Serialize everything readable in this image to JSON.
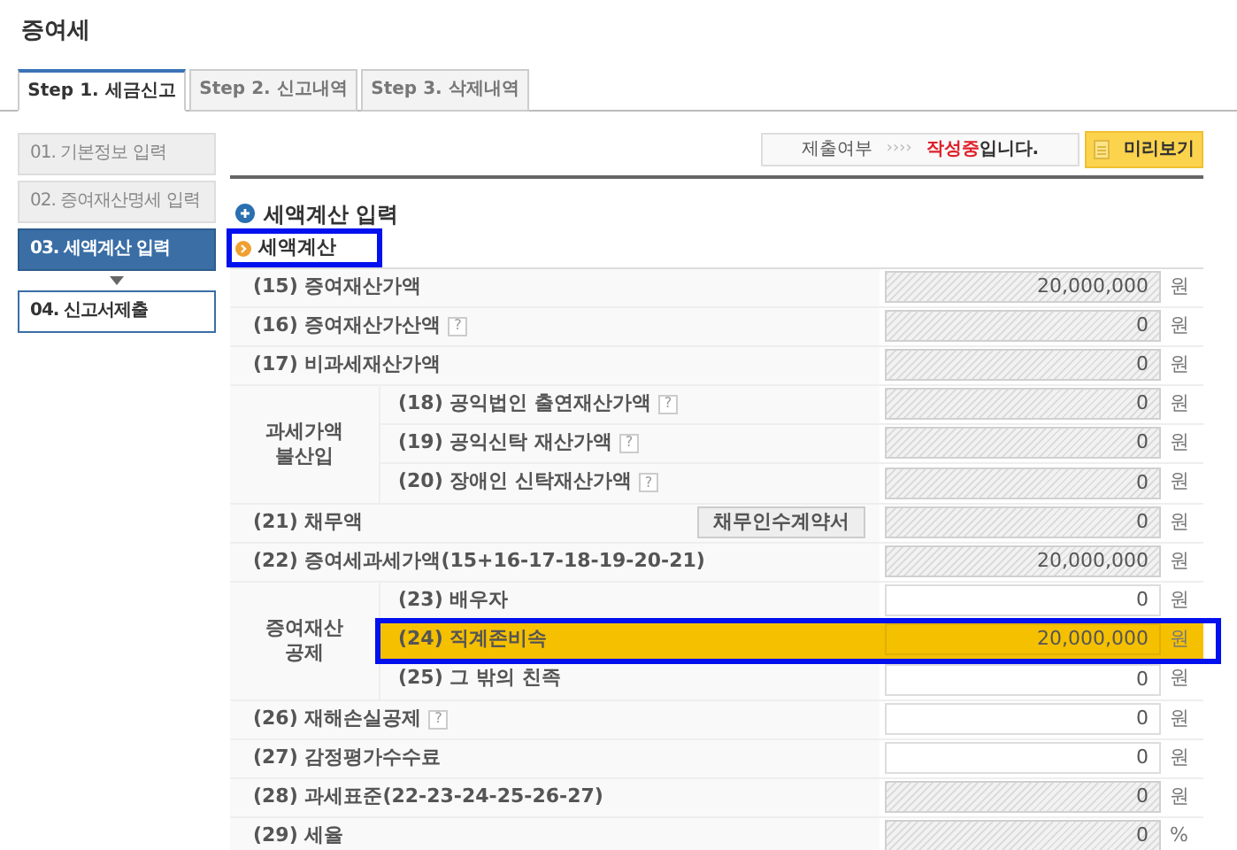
{
  "page_title": "증여세",
  "tabs": [
    {
      "label": "Step 1. 세금신고",
      "selected": true
    },
    {
      "label": "Step 2. 신고내역",
      "selected": false
    },
    {
      "label": "Step 3. 삭제내역",
      "selected": false
    }
  ],
  "steps": [
    {
      "label": "01. 기본정보 입력",
      "selected": false,
      "completed": true
    },
    {
      "label": "02. 증여재산명세 입력",
      "selected": false,
      "completed": true
    },
    {
      "label": "03. 세액계산 입력",
      "selected": true,
      "completed": false
    },
    {
      "label": "04. 신고서제출",
      "selected": false,
      "completed": false
    }
  ],
  "status": {
    "label": "제출여부",
    "arrows": "››››",
    "state": "작성중",
    "suffix": "입니다."
  },
  "preview_button": "미리보기",
  "section_title": "세액계산 입력",
  "subsection": {
    "title": "세액계산",
    "highlighted": true
  },
  "rows": [
    {
      "kind": "single",
      "label": "(15) 증여재산가액",
      "value": "20,000,000",
      "unit": "원",
      "editable": false
    },
    {
      "kind": "single",
      "label": "(16) 증여재산가산액",
      "help": "?",
      "value": "0",
      "unit": "원",
      "editable": false
    },
    {
      "kind": "single",
      "label": "(17) 비과세재산가액",
      "value": "0",
      "unit": "원",
      "editable": false
    },
    {
      "kind": "group",
      "label": "과세가액\n불산입",
      "children": [
        {
          "label": "(18) 공익법인 출연재산가액",
          "help": "?",
          "value": "0",
          "unit": "원",
          "editable": false,
          "highlighted": false
        },
        {
          "label": "(19) 공익신탁 재산가액",
          "help": "?",
          "value": "0",
          "unit": "원",
          "editable": false,
          "highlighted": false
        },
        {
          "label": "(20) 장애인 신탁재산가액",
          "help": "?",
          "value": "0",
          "unit": "원",
          "editable": false,
          "highlighted": false
        }
      ]
    },
    {
      "kind": "single",
      "label": "(21) 채무액",
      "button": "채무인수계약서",
      "value": "0",
      "unit": "원",
      "editable": false
    },
    {
      "kind": "single",
      "label": "(22) 증여세과세가액(15+16-17-18-19-20-21)",
      "value": "20,000,000",
      "unit": "원",
      "editable": false
    },
    {
      "kind": "group",
      "label": "증여재산\n공제",
      "children": [
        {
          "label": "(23) 배우자",
          "value": "0",
          "unit": "원",
          "editable": true,
          "highlighted": false
        },
        {
          "label": "(24) 직계존비속",
          "value": "20,000,000",
          "unit": "원",
          "editable": true,
          "highlighted": true
        },
        {
          "label": "(25) 그 밖의 친족",
          "value": "0",
          "unit": "원",
          "editable": true,
          "highlighted": false
        }
      ]
    },
    {
      "kind": "single",
      "label": "(26) 재해손실공제",
      "help": "?",
      "value": "0",
      "unit": "원",
      "editable": true
    },
    {
      "kind": "single",
      "label": "(27) 감정평가수수료",
      "value": "0",
      "unit": "원",
      "editable": true
    },
    {
      "kind": "single",
      "label": "(28) 과세표준(22-23-24-25-26-27)",
      "value": "0",
      "unit": "원",
      "editable": false
    },
    {
      "kind": "single",
      "label": "(29) 세율",
      "value": "0",
      "unit": "%",
      "editable": false
    }
  ]
}
